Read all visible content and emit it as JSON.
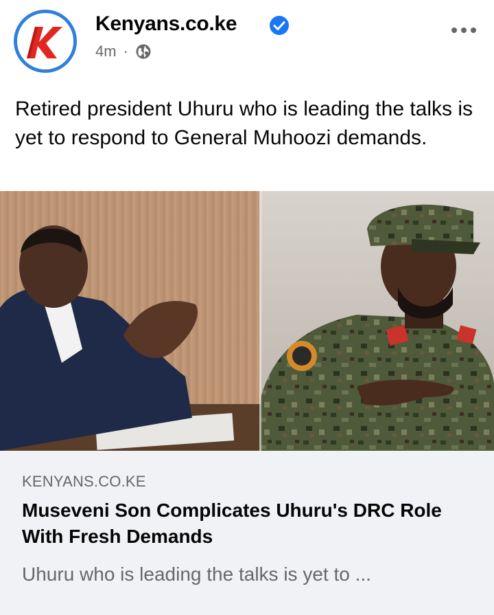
{
  "post": {
    "page_name": "Kenyans.co.ke",
    "time": "4m",
    "separator": "·",
    "audience_icon": "globe-icon",
    "verified_icon": "verified-badge-icon",
    "more_icon": "more-options-icon",
    "caption": "Retired president Uhuru who is leading the talks is yet to respond to General Muhoozi demands."
  },
  "link_preview": {
    "domain": "KENYANS.CO.KE",
    "title": "Museveni Son Complicates Uhuru's DRC Role With Fresh Demands",
    "description": "Uhuru who is leading the talks is yet to ..."
  },
  "colors": {
    "brand_blue": "#2f7fdc",
    "logo_red": "#e3261f",
    "card_bg": "#f0f2f5",
    "secondary_text": "#65676b"
  }
}
